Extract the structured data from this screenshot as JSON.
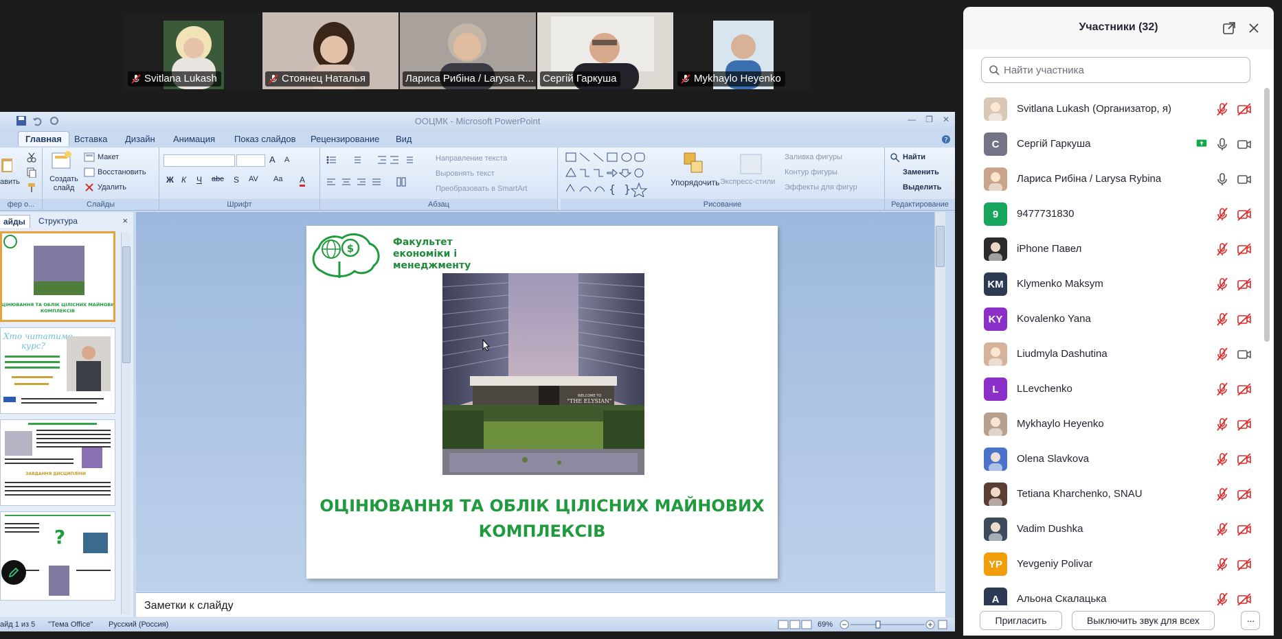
{
  "video_strip": {
    "tiles": [
      {
        "name": "Svitlana Lukash",
        "muted": true
      },
      {
        "name": "Стоянец Наталья",
        "muted": true
      },
      {
        "name": "Лариса Рибіна / Larysa R...",
        "muted": false
      },
      {
        "name": "Сергій Гаркуша",
        "muted": false,
        "active_speaker": true
      },
      {
        "name": "Mykhaylo Heyenko",
        "muted": true
      }
    ]
  },
  "powerpoint": {
    "window_title": "ООЦМК - Microsoft PowerPoint",
    "tabs": [
      "Главная",
      "Вставка",
      "Дизайн",
      "Анимация",
      "Показ слайдов",
      "Рецензирование",
      "Вид"
    ],
    "active_tab": "Главная",
    "ribbon": {
      "clipboard": {
        "paste_label": "авить",
        "group_label": "фер о..."
      },
      "slides": {
        "create_label": "Создать слайд",
        "layout": "Макет",
        "restore": "Восстановить",
        "delete": "Удалить",
        "group_label": "Слайды"
      },
      "font": {
        "bold": "Ж",
        "italic": "К",
        "underline": "Ч",
        "strike": "abc",
        "shadow": "S",
        "spacing": "AV",
        "case": "Aa",
        "color": "A",
        "grow": "A",
        "shrink": "A",
        "group_label": "Шрифт"
      },
      "paragraph": {
        "text_direction": "Направление текста",
        "align_text": "Выровнять текст",
        "smartart": "Преобразовать в SmartArt",
        "group_label": "Абзац"
      },
      "drawing": {
        "arrange": "Упорядочить",
        "quick_styles": "Экспресс-стили",
        "shape_fill": "Заливка фигуры",
        "shape_outline": "Контур фигуры",
        "shape_effects": "Эффекты для фигур",
        "group_label": "Рисование"
      },
      "editing": {
        "find": "Найти",
        "replace": "Заменить",
        "select": "Выделить",
        "group_label": "Редактирование"
      }
    },
    "left_panel": {
      "tabs": [
        "айды",
        "Структура"
      ],
      "close": "×"
    },
    "slide": {
      "faculty_lines": [
        "Факультет",
        "економіки і",
        "менеджменту"
      ],
      "photo_sign": [
        "WELCOME TO",
        "\"THE ELYSIAN\""
      ],
      "title_lines": [
        "ОЦІНЮВАННЯ ТА ОБЛІК ЦІЛІСНИХ МАЙНОВИХ",
        "КОМПЛЕКСІВ"
      ]
    },
    "thumbnails": [
      {
        "text": "ОЦІНЮВАННЯ ТА ОБЛІК ЦІЛІСНИХ МАЙНОВИХ КОМПЛЕКСІВ"
      },
      {
        "text": "Хто читатиме курс?"
      },
      {
        "text": "ЗАВДАННЯ ДИСЦИПЛІНИ"
      },
      {
        "text": "?"
      }
    ],
    "notes_placeholder": "Заметки к слайду",
    "status": {
      "slide_info": "айд 1 из 5",
      "theme": "\"Тема Office\"",
      "language": "Русский (Россия)",
      "zoom": "69%"
    }
  },
  "participants": {
    "title": "Участники (32)",
    "search_placeholder": "Найти участника",
    "list": [
      {
        "name": "Svitlana Lukash (Организатор, я)",
        "avatar_type": "photo",
        "avatar_color": "#d9c7b8",
        "mic": "muted",
        "video": "off",
        "share": false
      },
      {
        "name": "Сергій Гаркуша",
        "avatar_type": "letter",
        "initials": "С",
        "avatar_color": "#747487",
        "mic": "on",
        "video": "on",
        "share": true
      },
      {
        "name": "Лариса Рибіна / Larysa Rybina",
        "avatar_type": "photo",
        "avatar_color": "#c9a48a",
        "mic": "on",
        "video": "on",
        "share": false
      },
      {
        "name": "9477731830",
        "avatar_type": "letter",
        "initials": "9",
        "avatar_color": "#17a45b",
        "mic": "muted",
        "video": "off",
        "share": false
      },
      {
        "name": "iPhone Павел",
        "avatar_type": "photo",
        "avatar_color": "#2b2b2b",
        "mic": "muted",
        "video": "off",
        "share": false
      },
      {
        "name": "Klymenko Maksym",
        "avatar_type": "letter",
        "initials": "KM",
        "avatar_color": "#2d3a54",
        "mic": "muted",
        "video": "off",
        "share": false
      },
      {
        "name": "Kovalenko Yana",
        "avatar_type": "letter",
        "initials": "KY",
        "avatar_color": "#8b2fc9",
        "mic": "muted",
        "video": "off",
        "share": false
      },
      {
        "name": "Liudmyla Dashutina",
        "avatar_type": "photo",
        "avatar_color": "#d4b39a",
        "mic": "muted",
        "video": "on",
        "share": false
      },
      {
        "name": "LLevchenko",
        "avatar_type": "letter",
        "initials": "L",
        "avatar_color": "#8b2fc9",
        "mic": "muted",
        "video": "off",
        "share": false
      },
      {
        "name": "Mykhaylo Heyenko",
        "avatar_type": "photo",
        "avatar_color": "#b8a08e",
        "mic": "muted",
        "video": "off",
        "share": false
      },
      {
        "name": "Olena Slavkova",
        "avatar_type": "photo",
        "avatar_color": "#4a73c9",
        "mic": "muted",
        "video": "off",
        "share": false
      },
      {
        "name": "Tetiana Kharchenko, SNAU",
        "avatar_type": "photo",
        "avatar_color": "#5b3d33",
        "mic": "muted",
        "video": "off",
        "share": false
      },
      {
        "name": "Vadim Dushka",
        "avatar_type": "photo",
        "avatar_color": "#3d4a5c",
        "mic": "muted",
        "video": "off",
        "share": false
      },
      {
        "name": "Yevgeniy Polivar",
        "avatar_type": "letter",
        "initials": "YP",
        "avatar_color": "#f29d0a",
        "mic": "muted",
        "video": "off",
        "share": false
      },
      {
        "name": "Альона Скалацька",
        "avatar_type": "letter",
        "initials": "А",
        "avatar_color": "#2d3a54",
        "mic": "muted",
        "video": "off",
        "share": false
      }
    ],
    "footer": {
      "invite": "Пригласить",
      "mute_all": "Выключить звук для всех",
      "more": "···"
    }
  },
  "colors": {
    "muted_red": "#e02828",
    "active_green": "#23d18b",
    "share_green": "#12a84b",
    "slide_green": "#1f9a3c"
  }
}
